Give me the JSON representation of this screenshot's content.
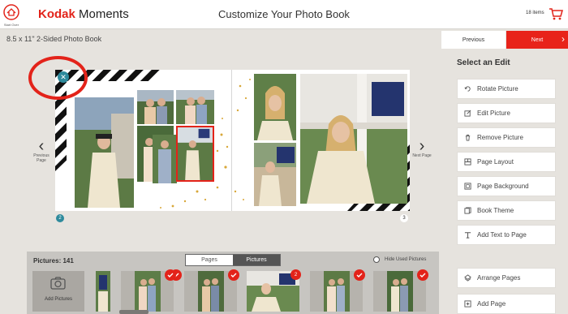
{
  "header": {
    "start_over_label": "Start Over",
    "brand_bold": "Kodak",
    "brand_rest": " Moments",
    "title": "Customize Your Photo Book",
    "cart_count": "18 items",
    "cart_icon": "cart-icon"
  },
  "book": {
    "title": "8.5 x 11\" 2-Sided Photo Book",
    "left_page_number": "2",
    "right_page_number": "3"
  },
  "navigation": {
    "previous_button": "Previous",
    "next_button": "Next",
    "previous_page_label": "Previous Page",
    "next_page_label": "Next Page"
  },
  "edit_panel": {
    "heading": "Select an Edit",
    "items": [
      {
        "label": "Rotate Picture",
        "icon": "rotate-icon"
      },
      {
        "label": "Edit Picture",
        "icon": "edit-icon"
      },
      {
        "label": "Remove Picture",
        "icon": "trash-icon"
      },
      {
        "label": "Page Layout",
        "icon": "layout-icon"
      },
      {
        "label": "Page Background",
        "icon": "background-icon"
      },
      {
        "label": "Book Theme",
        "icon": "theme-icon"
      },
      {
        "label": "Add Text to Page",
        "icon": "text-icon"
      }
    ],
    "arrange_pages": "Arrange Pages",
    "add_page": "Add Page"
  },
  "picture_strip": {
    "count_label": "Pictures: 141",
    "tabs": [
      {
        "label": "Pages",
        "active": false
      },
      {
        "label": "Pictures",
        "active": true
      }
    ],
    "hide_used_label": "Hide Used Pictures",
    "add_pictures_label": "Add Pictures",
    "used_badge_count": "2"
  },
  "colors": {
    "brand_red": "#e2231a",
    "next_button": "#e8231a",
    "teal_badge": "#2e8a9c",
    "strip_background": "#c7c5c1",
    "gold_confetti": "#d8a83a"
  }
}
